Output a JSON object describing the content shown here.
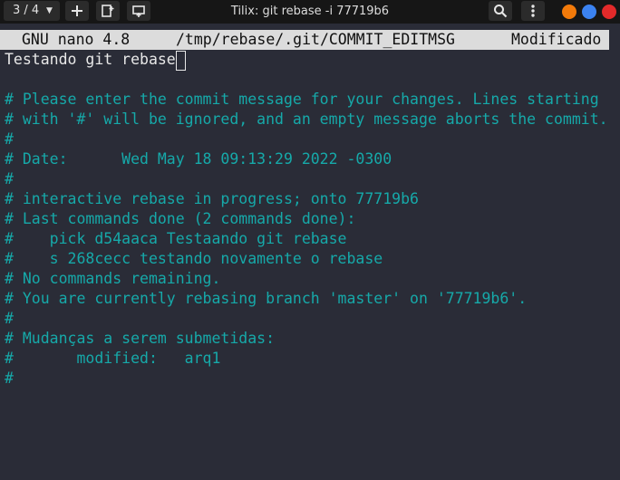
{
  "titlebar": {
    "session_label": "3 / 4",
    "title": "Tilix: git rebase -i 77719b6",
    "icons": [
      "chevron-down-icon",
      "plus-icon",
      "add-terminal-right-icon",
      "add-terminal-down-icon",
      "search-icon",
      "more-vert-icon"
    ],
    "window_buttons": [
      "#f27a0a",
      "#3b82f0",
      "#e32a2a"
    ]
  },
  "nano": {
    "version": "GNU nano 4.8",
    "filename": "/tmp/rebase/.git/COMMIT_EDITMSG",
    "status": "Modificado"
  },
  "buffer": {
    "message": "Testando git rebase",
    "lines": [
      "",
      "# Please enter the commit message for your changes. Lines starting",
      "# with '#' will be ignored, and an empty message aborts the commit.",
      "#",
      "# Date:      Wed May 18 09:13:29 2022 -0300",
      "#",
      "# interactive rebase in progress; onto 77719b6",
      "# Last commands done (2 commands done):",
      "#    pick d54aaca Testaando git rebase",
      "#    s 268cecc testando novamente o rebase",
      "# No commands remaining.",
      "# You are currently rebasing branch 'master' on '77719b6'.",
      "#",
      "# Mudanças a serem submetidas:",
      "#       modified:   arq1",
      "#"
    ]
  }
}
